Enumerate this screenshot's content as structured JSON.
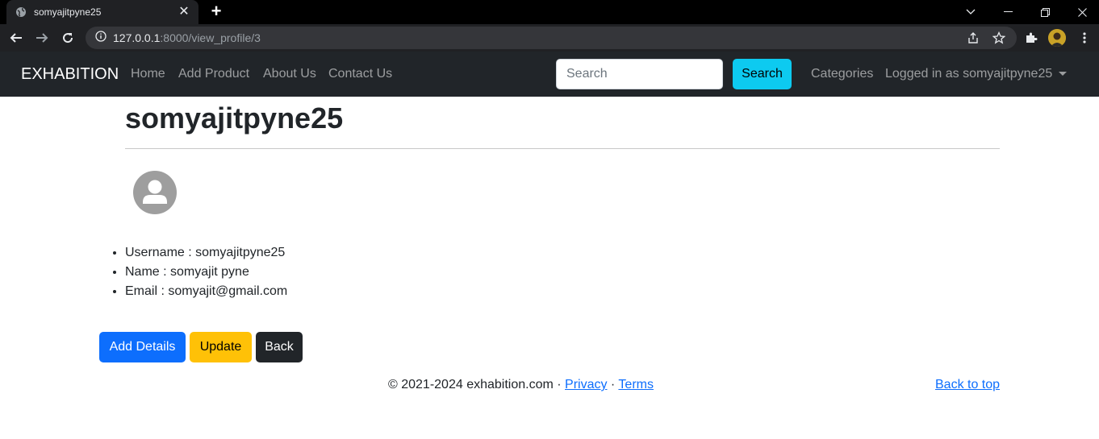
{
  "browser": {
    "tab_title": "somyajitpyne25",
    "url_host": "127.0.0.1",
    "url_path": ":8000/view_profile/3"
  },
  "navbar": {
    "brand": "EXHABITION",
    "links": [
      "Home",
      "Add Product",
      "About Us",
      "Contact Us"
    ],
    "search_placeholder": "Search",
    "search_button": "Search",
    "categories": "Categories",
    "user_menu": "Logged in as somyajitpyne25"
  },
  "profile": {
    "title": "somyajitpyne25",
    "details": [
      "Username : somyajitpyne25",
      "Name : somyajit pyne",
      "Email : somyajit@gmail.com"
    ]
  },
  "actions": {
    "add_details": "Add Details",
    "update": "Update",
    "back": "Back"
  },
  "footer": {
    "copyright": "© 2021-2024 exhabition.com · ",
    "privacy": "Privacy",
    "separator": " · ",
    "terms": "Terms",
    "back_to_top": "Back to top"
  }
}
